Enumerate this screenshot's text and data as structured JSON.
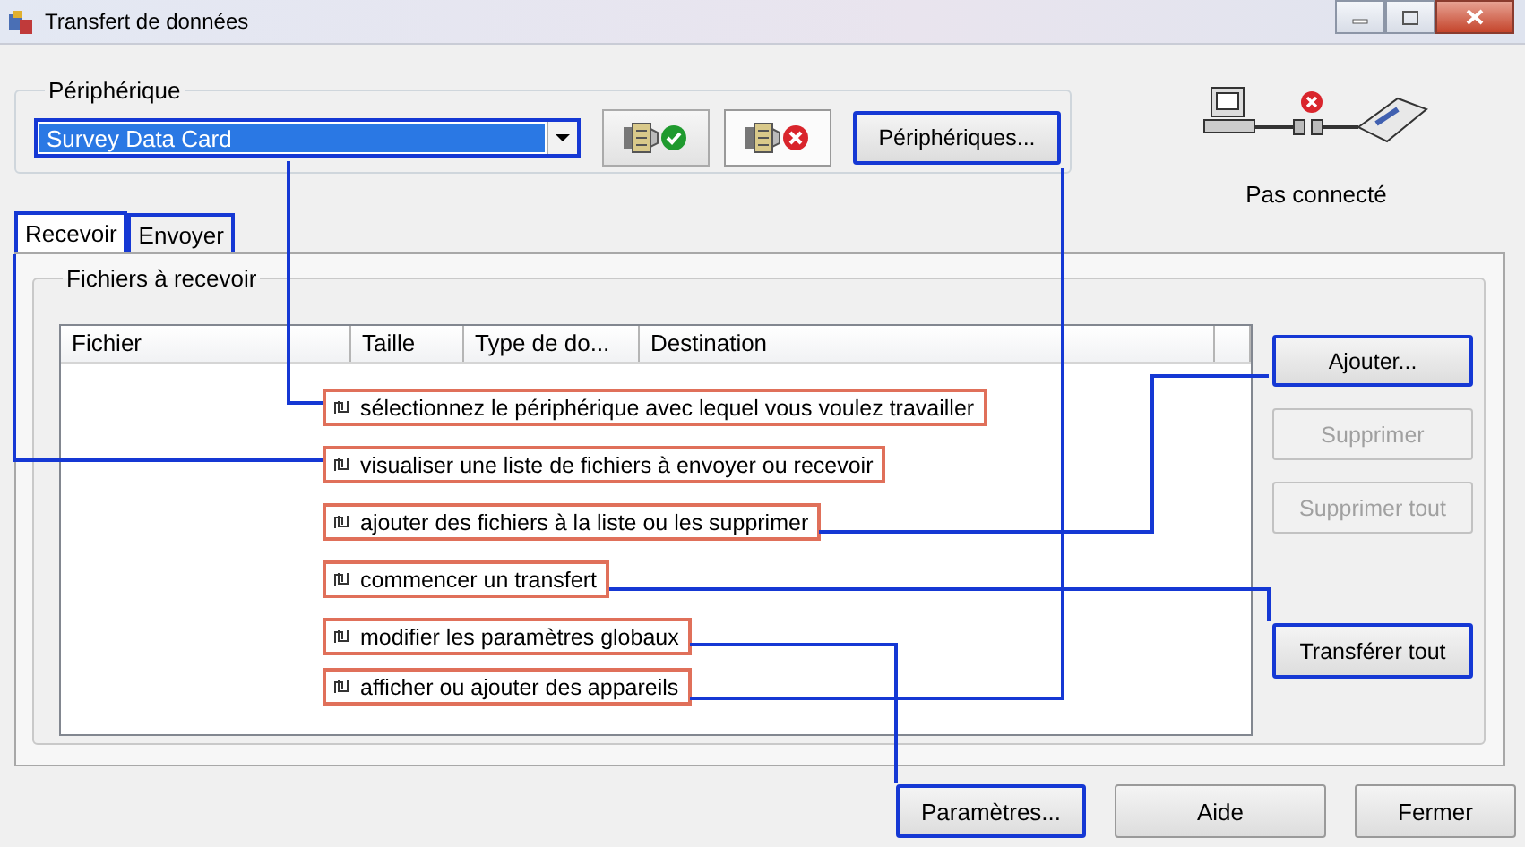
{
  "window": {
    "title": "Transfert de données"
  },
  "device_group": {
    "label": "Périphérique",
    "device": {
      "value": "Survey Data Card",
      "highlighted": true
    },
    "peripherals_button": {
      "label": "Périphériques...",
      "highlighted": true
    }
  },
  "status": {
    "text": "Pas connecté"
  },
  "tabs": [
    {
      "label": "Recevoir",
      "selected": true,
      "highlighted": true
    },
    {
      "label": "Envoyer",
      "selected": false,
      "highlighted": true
    }
  ],
  "files_group": {
    "label": "Fichiers à recevoir",
    "columns": [
      "Fichier",
      "Taille",
      "Type de do...",
      "Destination"
    ]
  },
  "side_buttons": [
    {
      "label": "Ajouter...",
      "disabled": false,
      "highlighted": true
    },
    {
      "label": "Supprimer",
      "disabled": true,
      "highlighted": false
    },
    {
      "label": "Supprimer tout",
      "disabled": true,
      "highlighted": false
    },
    {
      "label": "Transférer tout",
      "disabled": false,
      "highlighted": true
    }
  ],
  "callouts": [
    {
      "text": "sélectionnez le périphérique avec lequel vous voulez travailler"
    },
    {
      "text": "visualiser une liste de fichiers à envoyer ou recevoir"
    },
    {
      "text": "ajouter des fichiers à la liste ou les supprimer"
    },
    {
      "text": "commencer un transfert"
    },
    {
      "text": "modifier les paramètres globaux"
    },
    {
      "text": "afficher ou ajouter des appareils"
    }
  ],
  "bottom_buttons": [
    {
      "label": "Paramètres...",
      "highlighted": true
    },
    {
      "label": "Aide",
      "highlighted": false
    },
    {
      "label": "Fermer",
      "highlighted": false
    }
  ]
}
